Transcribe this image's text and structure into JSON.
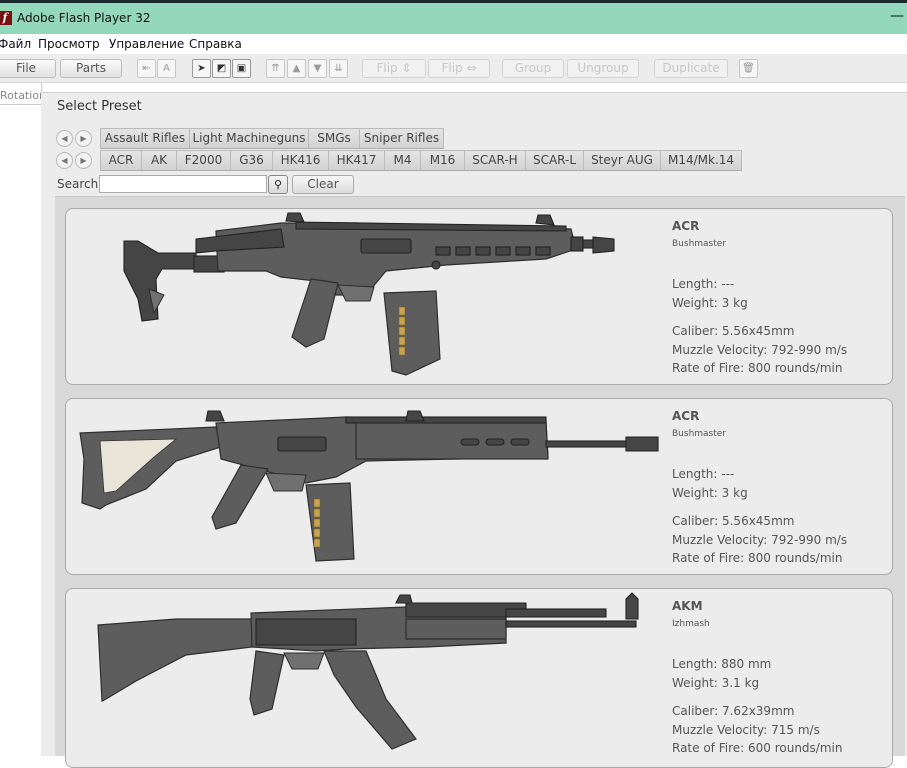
{
  "window": {
    "title": "Adobe Flash Player 32",
    "minimize": "—"
  },
  "menu": [
    "Файл",
    "Просмотр",
    "Управление",
    "Справка"
  ],
  "toolbar": {
    "file": "File",
    "parts": "Parts",
    "flip_v": "Flip ⇕",
    "flip_h": "Flip ⇔",
    "group": "Group",
    "ungroup": "Ungroup",
    "duplicate": "Duplicate"
  },
  "left_panel": {
    "rotation_label": "Rotation"
  },
  "dialog": {
    "title": "Select Preset",
    "categories": [
      "Assault Rifles",
      "Light Machineguns",
      "SMGs",
      "Sniper Rifles"
    ],
    "models": [
      "ACR",
      "AK",
      "F2000",
      "G36",
      "HK416",
      "HK417",
      "M4",
      "M16",
      "SCAR-H",
      "SCAR-L",
      "Steyr AUG",
      "M14/Mk.14"
    ],
    "search_label": "Search:",
    "search_value": "",
    "search_icon": "magnifier-icon",
    "clear_label": "Clear"
  },
  "presets": [
    {
      "name": "ACR",
      "maker": "Bushmaster",
      "length": "Length: ---",
      "weight": "Weight: 3 kg",
      "caliber": "Caliber: 5.56x45mm",
      "velocity": "Muzzle Velocity: 792-990 m/s",
      "rof": "Rate of Fire: 800 rounds/min"
    },
    {
      "name": "ACR",
      "maker": "Bushmaster",
      "length": "Length: ---",
      "weight": "Weight: 3 kg",
      "caliber": "Caliber: 5.56x45mm",
      "velocity": "Muzzle Velocity: 792-990 m/s",
      "rof": "Rate of Fire: 800 rounds/min"
    },
    {
      "name": "AKM",
      "maker": "Izhmash",
      "length": "Length: 880 mm",
      "weight": "Weight: 3.1 kg",
      "caliber": "Caliber: 7.62x39mm",
      "velocity": "Muzzle Velocity: 715 m/s",
      "rof": "Rate of Fire: 600 rounds/min"
    }
  ]
}
